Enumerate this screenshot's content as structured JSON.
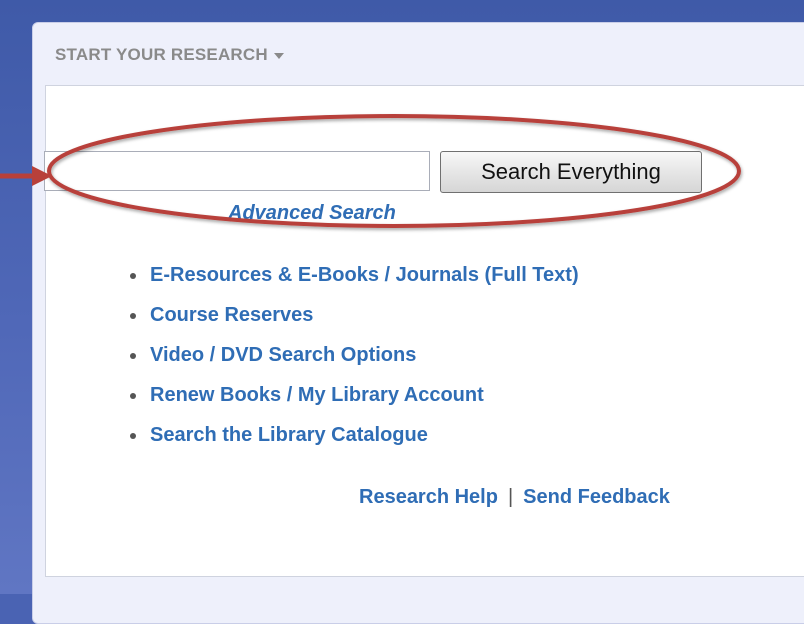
{
  "panel": {
    "header_label": "START YOUR RESEARCH"
  },
  "search": {
    "input_value": "",
    "button_label": "Search Everything",
    "advanced_label": "Advanced Search"
  },
  "resources": [
    {
      "label": "E-Resources & E-Books / Journals (Full Text)"
    },
    {
      "label": "Course Reserves"
    },
    {
      "label": "Video / DVD Search Options"
    },
    {
      "label": "Renew Books / My Library Account"
    },
    {
      "label": "Search the Library Catalogue"
    }
  ],
  "footer": {
    "research_help": "Research Help",
    "separator": "|",
    "send_feedback": "Send Feedback"
  },
  "annotation": {
    "ellipse_color": "#b8403a",
    "arrow_color": "#b8403a"
  }
}
